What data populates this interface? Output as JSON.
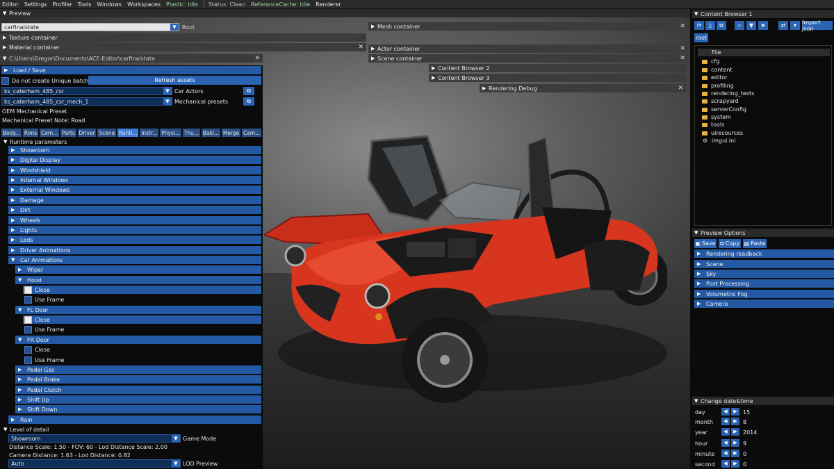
{
  "menubar": {
    "menus": [
      "Editor",
      "Settings",
      "Profiler",
      "Tools",
      "Windows",
      "Workspaces"
    ],
    "plastic_status": "Plastic: Idle",
    "status": "Status: Clean",
    "refcache_status": "ReferenceCache: Idle",
    "renderer": "Renderer"
  },
  "preview": {
    "title": "Preview",
    "asset_combo_value": "carfinalstate",
    "asset_combo_label": "Root",
    "texture_container": "Texture container",
    "material_container": "Material container",
    "path_window_title": "C:\\Users\\Gregor\\Documents\\ACE-Editor\\carfinalstate",
    "mesh_container": "Mesh container",
    "actor_container": "Actor container",
    "scene_container": "Scene container",
    "content_browser_2": "Content Browser 2",
    "content_browser_3": "Content Browser 3",
    "rendering_debug": "Rendering Debug"
  },
  "left_panel": {
    "load_save": "Load / Save",
    "unique_batches": "Do not create Unique batches",
    "refresh_assets": "Refresh assets",
    "car_actors_value": "ks_caterham_485_csr",
    "car_actors_label": "Car Actors",
    "mech_presets_value": "ks_caterham_485_csr_mech_1",
    "mech_presets_label": "Mechanical presets",
    "oem_preset": "OEM Mechanical Preset",
    "preset_note": "Mechanical Preset Note: Road",
    "tabs": [
      "Body...",
      "Rims",
      "Com...",
      "Parts",
      "Driver",
      "Scene",
      "Runti...",
      "Instr...",
      "Physi...",
      "Thu...",
      "Baki...",
      "Merge",
      "Cam..."
    ],
    "active_tab_index": 6,
    "runtime_params": "Runtime parameters",
    "params": [
      "Showroom",
      "Digital Display",
      "Windshield",
      "Internal Windows",
      "External Windows",
      "Damage",
      "Dirt",
      "Wheels",
      "Lights",
      "Leds",
      "Driver Animations",
      "Car Animations"
    ],
    "car_anims": {
      "wiper": "Wiper",
      "hood": "Hood",
      "hood_close": "Close",
      "hood_use_frame": "Use Frame",
      "fl_door": "FL Door",
      "fl_close": "Close",
      "fl_use_frame": "Use Frame",
      "fr_door": "FR Door",
      "fr_close": "Close",
      "fr_use_frame": "Use Frame",
      "more": [
        "Pedal Gas",
        "Pedal Brake",
        "Pedal Clutch",
        "Shift Up",
        "Shift Down"
      ]
    },
    "rain": "Rain",
    "lod": {
      "title": "Level of detail",
      "mode_value": "Showroom",
      "mode_label": "Game Mode",
      "distance_info": "Distance Scale: 1.50 - FOV: 60 - Lod Distance Scale: 2.00",
      "camera_info": "Camera Distance: 1.63 - Lod Distance: 0.82",
      "preview_value": "Auto",
      "preview_label": "LOD Preview"
    }
  },
  "content_browser": {
    "title": "Content Browser 1",
    "import_json": "Import Json",
    "root": "root",
    "file_header": "File",
    "items": [
      {
        "name": "cfg",
        "kind": "folder"
      },
      {
        "name": "content",
        "kind": "folder"
      },
      {
        "name": "editor",
        "kind": "folder"
      },
      {
        "name": "profiling",
        "kind": "folder"
      },
      {
        "name": "rendering_tests",
        "kind": "folder"
      },
      {
        "name": "scrapyard",
        "kind": "folder"
      },
      {
        "name": "serverConfig",
        "kind": "folder"
      },
      {
        "name": "system",
        "kind": "folder"
      },
      {
        "name": "tools",
        "kind": "folder"
      },
      {
        "name": "uiresources",
        "kind": "folder"
      },
      {
        "name": "imgui.ini",
        "kind": "settings-file"
      }
    ]
  },
  "preview_options": {
    "title": "Preview Options",
    "save": "Save",
    "copy": "Copy",
    "paste": "Paste",
    "sections": [
      "Rendering readback",
      "Scene",
      "Sky",
      "Post Processing",
      "Volumetric Fog",
      "Camera"
    ]
  },
  "datetime": {
    "title": "Change date&time",
    "fields": [
      {
        "label": "day",
        "value": "15"
      },
      {
        "label": "month",
        "value": "8"
      },
      {
        "label": "year",
        "value": "2014"
      },
      {
        "label": "hour",
        "value": "9"
      },
      {
        "label": "minute",
        "value": "0"
      },
      {
        "label": "second",
        "value": "0"
      }
    ]
  },
  "colors": {
    "accent": "#2359a5",
    "button": "#2c64b4",
    "car_body": "#d8351f",
    "folder": "#e9b23c"
  }
}
